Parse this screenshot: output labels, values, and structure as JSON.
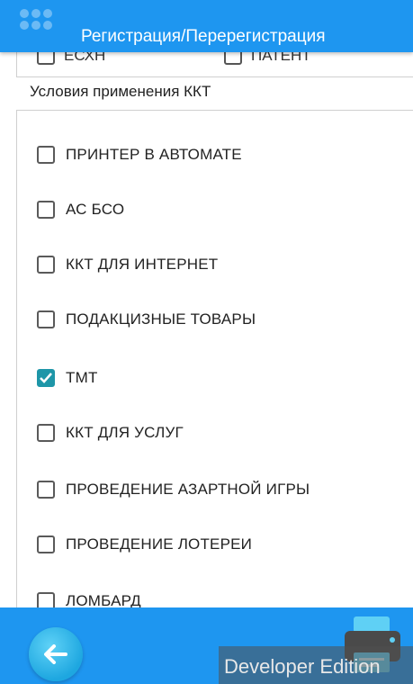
{
  "app_bar": {
    "title": "Регистрация/Перерегистрация",
    "menu_icon": "app-menu-icon"
  },
  "partial_row": {
    "left_label": "ЕСХН",
    "right_label": "ПАТЕНТ"
  },
  "section": {
    "title": "Условия применения ККТ"
  },
  "options": [
    {
      "label": "ПРИНТЕР В АВТОМАТЕ",
      "checked": false
    },
    {
      "label": "АС БСО",
      "checked": false
    },
    {
      "label": "ККТ ДЛЯ ИНТЕРНЕТ",
      "checked": false
    },
    {
      "label": "ПОДАКЦИЗНЫЕ ТОВАРЫ",
      "checked": false
    },
    {
      "label": "ТМТ",
      "checked": true
    },
    {
      "label": "ККТ ДЛЯ УСЛУГ",
      "checked": false
    },
    {
      "label": "ПРОВЕДЕНИЕ АЗАРТНОЙ ИГРЫ",
      "checked": false
    },
    {
      "label": "ПРОВЕДЕНИЕ ЛОТЕРЕИ",
      "checked": false
    },
    {
      "label": "ЛОМБАРД",
      "checked": false
    }
  ],
  "bottom_bar": {
    "back_icon": "arrow-left-icon",
    "print_icon": "printer-icon"
  },
  "watermark": {
    "text": "Developer Edition"
  },
  "colors": {
    "primary": "#1e96f0",
    "checkbox_checked": "#1e96a8"
  }
}
